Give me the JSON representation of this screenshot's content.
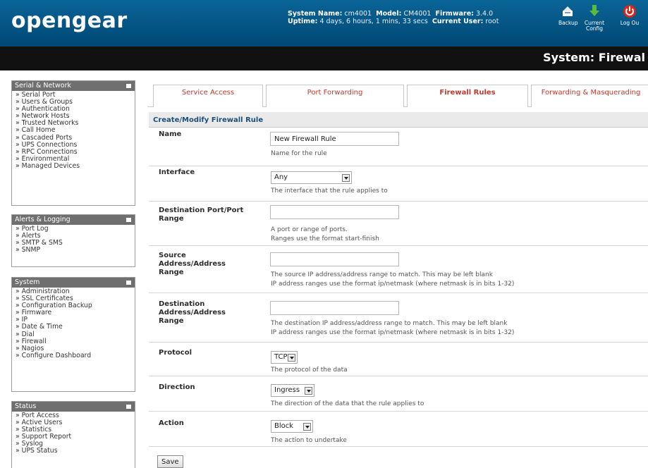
{
  "header": {
    "logo": "opengear",
    "system_name_label": "System Name:",
    "system_name": "cm4001",
    "model_label": "Model:",
    "model": "CM4001",
    "firmware_label": "Firmware:",
    "firmware": "3.4.0",
    "uptime_label": "Uptime:",
    "uptime": "4 days, 6 hours, 1 mins, 33 secs",
    "current_user_label": "Current User:",
    "current_user": "root",
    "buttons": {
      "backup": "Backup",
      "current_config_line1": "Current",
      "current_config_line2": "Config",
      "logout": "Log Ou"
    }
  },
  "page_title": "System: Firewal",
  "sidebar": {
    "serial_network": {
      "title": "Serial & Network",
      "items": [
        "» Serial Port",
        "» Users & Groups",
        "» Authentication",
        "» Network Hosts",
        "» Trusted Networks",
        "» Call Home",
        "» Cascaded Ports",
        "» UPS Connections",
        "» RPC Connections",
        "» Environmental",
        "» Managed Devices"
      ]
    },
    "alerts_logging": {
      "title": "Alerts & Logging",
      "items": [
        "» Port Log",
        "» Alerts",
        "» SMTP & SMS",
        "» SNMP"
      ]
    },
    "system": {
      "title": "System",
      "items": [
        "» Administration",
        "» SSL Certificates",
        "» Configuration Backup",
        "» Firmware",
        "» IP",
        "» Date & Time",
        "» Dial",
        "» Firewall",
        "» Nagios",
        "» Configure Dashboard"
      ]
    },
    "status": {
      "title": "Status",
      "items": [
        "» Port Access",
        "» Active Users",
        "» Statistics",
        "» Support Report",
        "» Syslog",
        "» UPS Status"
      ]
    }
  },
  "tabs": [
    {
      "label": "Service Access"
    },
    {
      "label": "Port Forwarding"
    },
    {
      "label": "Firewall Rules",
      "active": true
    },
    {
      "label": "Forwarding & Masquerading"
    }
  ],
  "form": {
    "header": "Create/Modify Firewall Rule",
    "name": {
      "label": "Name",
      "value": "New Firewall Rule",
      "help": "Name for the rule"
    },
    "interface": {
      "label": "Interface",
      "value": "Any",
      "help": "The interface that the rule applies to"
    },
    "dest_port": {
      "label": "Destination Port/Port Range",
      "value": "",
      "help1": "A port or range of ports.",
      "help2": "Ranges use the format start-finish"
    },
    "source_addr": {
      "label": "Source Address/Address Range",
      "value": "",
      "help1": "The source IP address/address range to match.  This may be left blank",
      "help2": "IP address ranges use the format ip/netmask (where netmask is in bits 1-32)"
    },
    "dest_addr": {
      "label": "Destination Address/Address Range",
      "value": "",
      "help1": "The destination IP address/address range to match.  This may be left blank",
      "help2": "IP address ranges use the format ip/netmask (where netmask is in bits 1-32)"
    },
    "protocol": {
      "label": "Protocol",
      "value": "TCP",
      "help": "The protocol of the data"
    },
    "direction": {
      "label": "Direction",
      "value": "Ingress",
      "help": "The direction of the data that the rule applies to"
    },
    "action": {
      "label": "Action",
      "value": "Block",
      "help": "The action to undertake"
    },
    "save_label": "Save"
  },
  "colors": {
    "header_blue": "#004e7c",
    "tab_text": "#c0392b",
    "form_header_text": "#1a4f7a"
  }
}
